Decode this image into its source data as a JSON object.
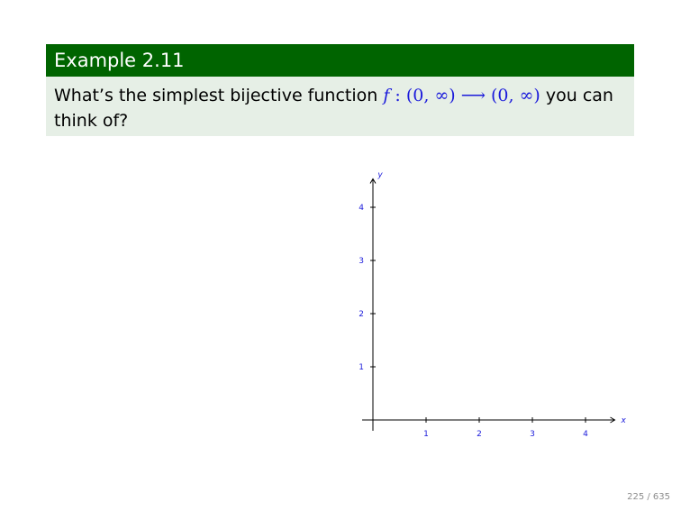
{
  "block": {
    "title": "Example 2.11",
    "text_before": "What’s the simplest bijective function ",
    "math_f": "f",
    "math_mapping": " : (0, ∞) ⟶ (0, ∞)",
    "text_after": " you can think of?"
  },
  "chart_data": {
    "type": "line",
    "series": [],
    "xlabel": "x",
    "ylabel": "y",
    "x_ticks": [
      "1",
      "2",
      "3",
      "4"
    ],
    "y_ticks": [
      "1",
      "2",
      "3",
      "4"
    ],
    "xlim": [
      0,
      4.5
    ],
    "ylim": [
      0,
      4.5
    ],
    "grid": false
  },
  "footer": {
    "slide_number": "225 / 635"
  },
  "colors": {
    "title_bar": "#006400",
    "body_bg": "#e6efe6",
    "math": "#1a1adb",
    "axis_label": "#1a1adb"
  }
}
